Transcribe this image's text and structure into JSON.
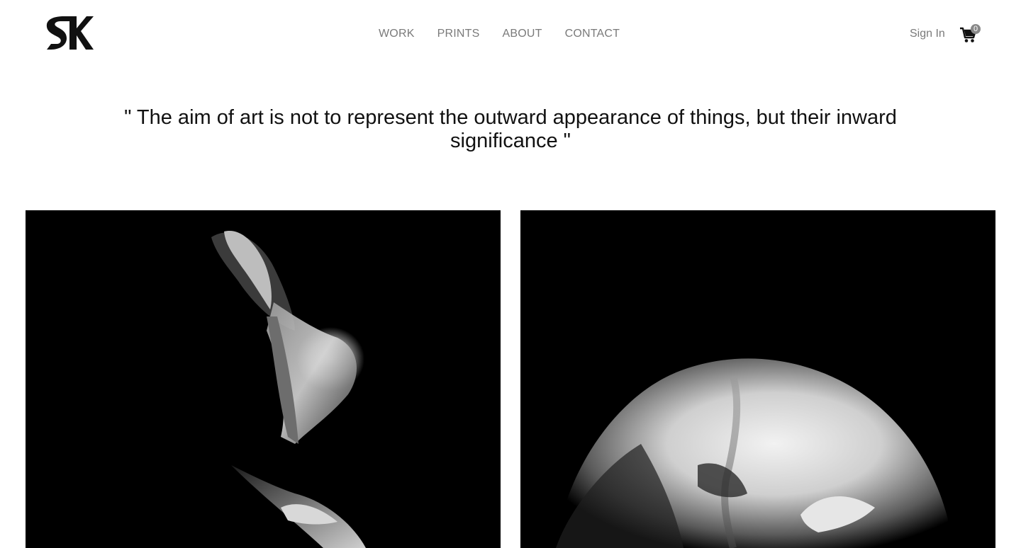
{
  "header": {
    "logo_icon": "sk-monogram-logo",
    "nav": [
      {
        "label": "WORK"
      },
      {
        "label": "PRINTS"
      },
      {
        "label": "ABOUT"
      },
      {
        "label": "CONTACT"
      }
    ],
    "sign_in_label": "Sign In",
    "cart": {
      "icon": "cart-icon",
      "count": "0"
    }
  },
  "quote": "\" The aim of art is not to represent the outward appearance of things, but their inward significance \"",
  "gallery": [
    {
      "name": "photo-figure-hand-on-head"
    },
    {
      "name": "photo-curved-back"
    }
  ],
  "colors": {
    "nav_text": "#7a7a7a",
    "background": "#ffffff",
    "photo_bg": "#000000"
  }
}
